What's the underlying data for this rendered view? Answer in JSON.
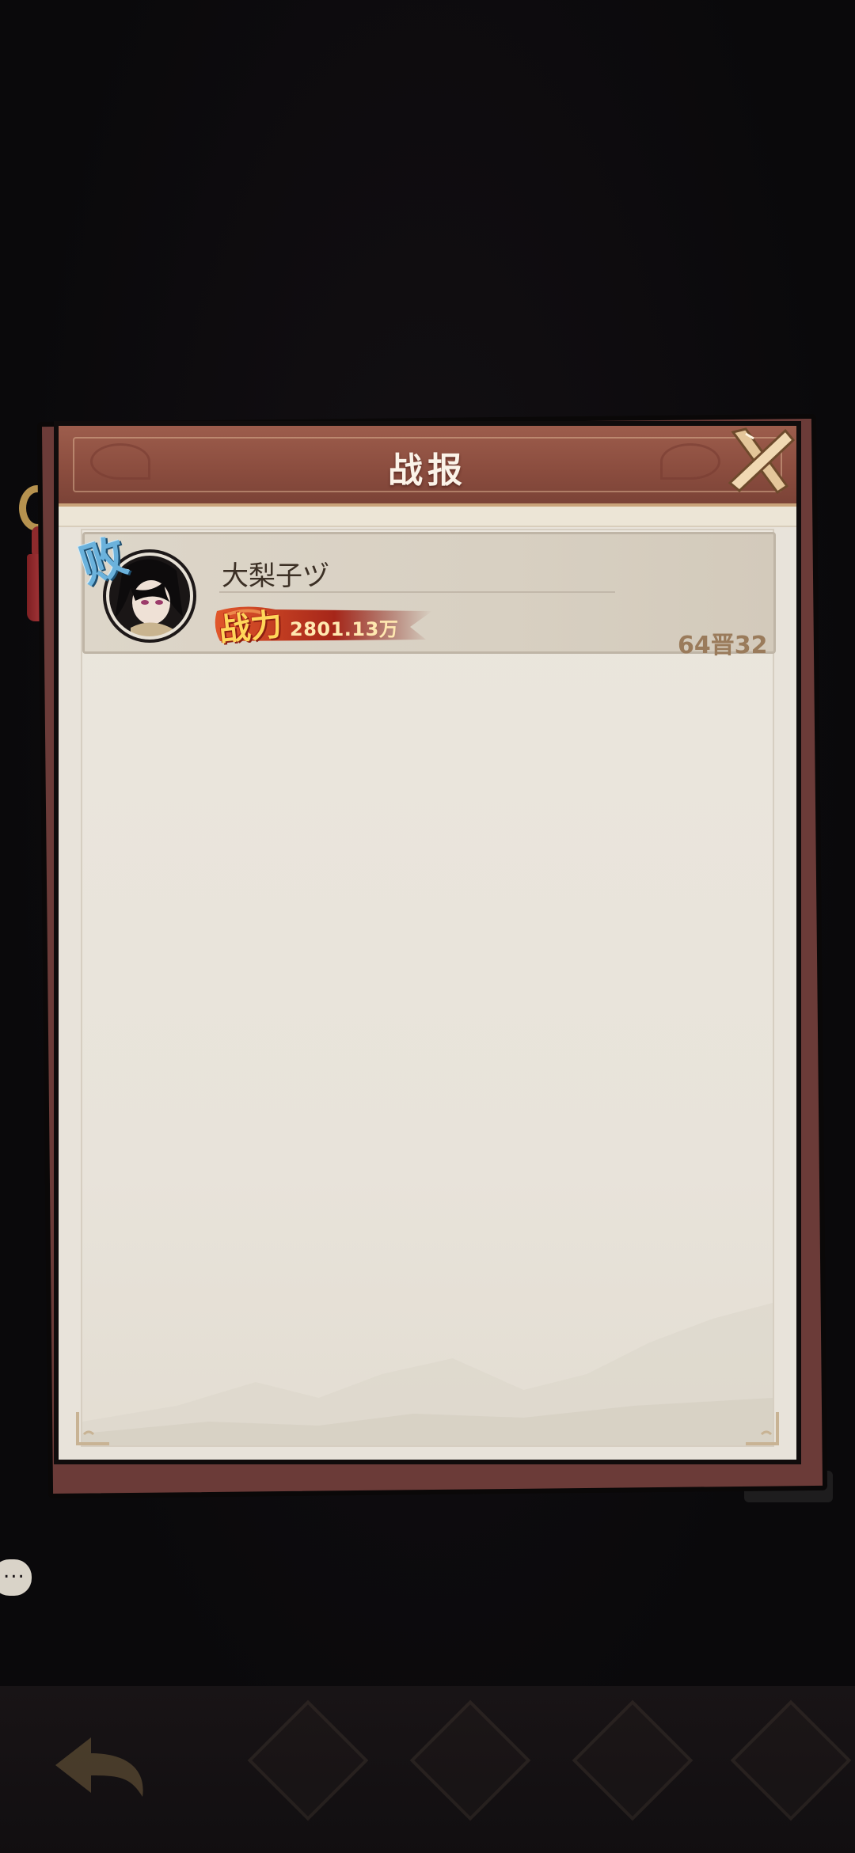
{
  "dialog": {
    "title": "战报"
  },
  "records": [
    {
      "result": "败",
      "player_name": "大梨子ヅ",
      "power_label": "战力",
      "power_value": "2801.13万",
      "round": "64晋32"
    }
  ],
  "colors": {
    "header": "#8a4c3e",
    "panel_bg": "#e8e3da",
    "defeat": "#6bb2dc",
    "power_banner": "#c0392b",
    "round_text": "#9a7b5b"
  },
  "icons": {
    "close": "close-x-icon",
    "chat": "chat-bubble-icon",
    "back": "back-arrow-icon"
  }
}
